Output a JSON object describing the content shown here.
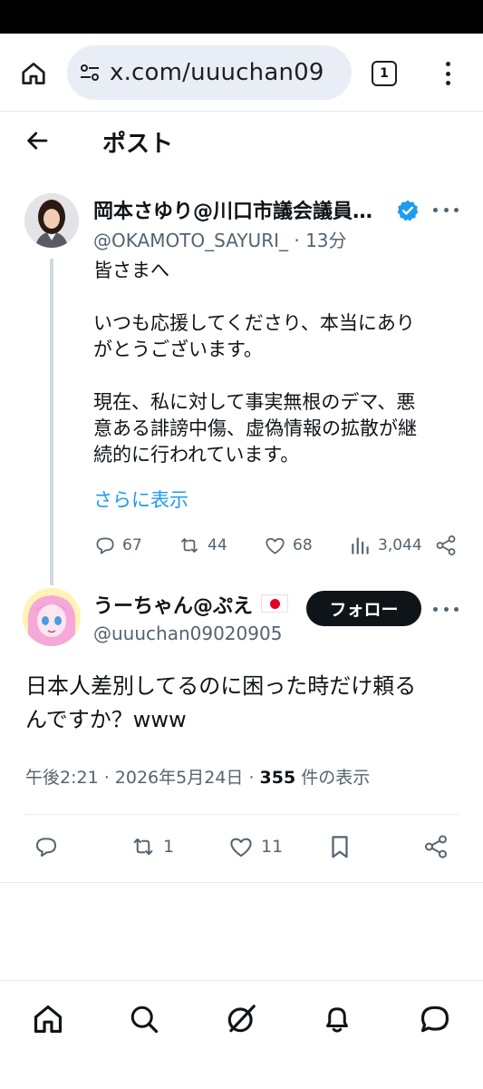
{
  "browser": {
    "url": "x.com/uuuchan09",
    "tab_count": "1"
  },
  "header": {
    "title": "ポスト"
  },
  "parent_tweet": {
    "display_name": "岡本さゆり@川口市議会議員…",
    "handle": "@OKAMOTO_SAYURI_ · 13分",
    "body_lines": [
      "皆さまへ",
      "",
      "いつも応援してくださり、本当にあり",
      "がとうございます。",
      "",
      "現在、私に対して事実無根のデマ、悪",
      "意ある誹謗中傷、虚偽情報の拡散が継",
      "続的に行われています。"
    ],
    "show_more": "さらに表示",
    "replies": "67",
    "reposts": "44",
    "likes": "68",
    "views": "3,044"
  },
  "main_tweet": {
    "display_name": "うーちゃん@ぷえ",
    "handle": "@uuuchan09020905",
    "follow_label": "フォロー",
    "body_lines": [
      "日本人差別してるのに困った時だけ頼る",
      "んですか？www"
    ],
    "time": "午後2:21 · 2026年5月24日 · ",
    "view_count": "355",
    "view_suffix": " 件の表示",
    "reposts": "1",
    "likes": "11"
  },
  "colors": {
    "accent": "#1d9bf0",
    "text_secondary": "#536471",
    "follow_bg": "#0f1419"
  }
}
